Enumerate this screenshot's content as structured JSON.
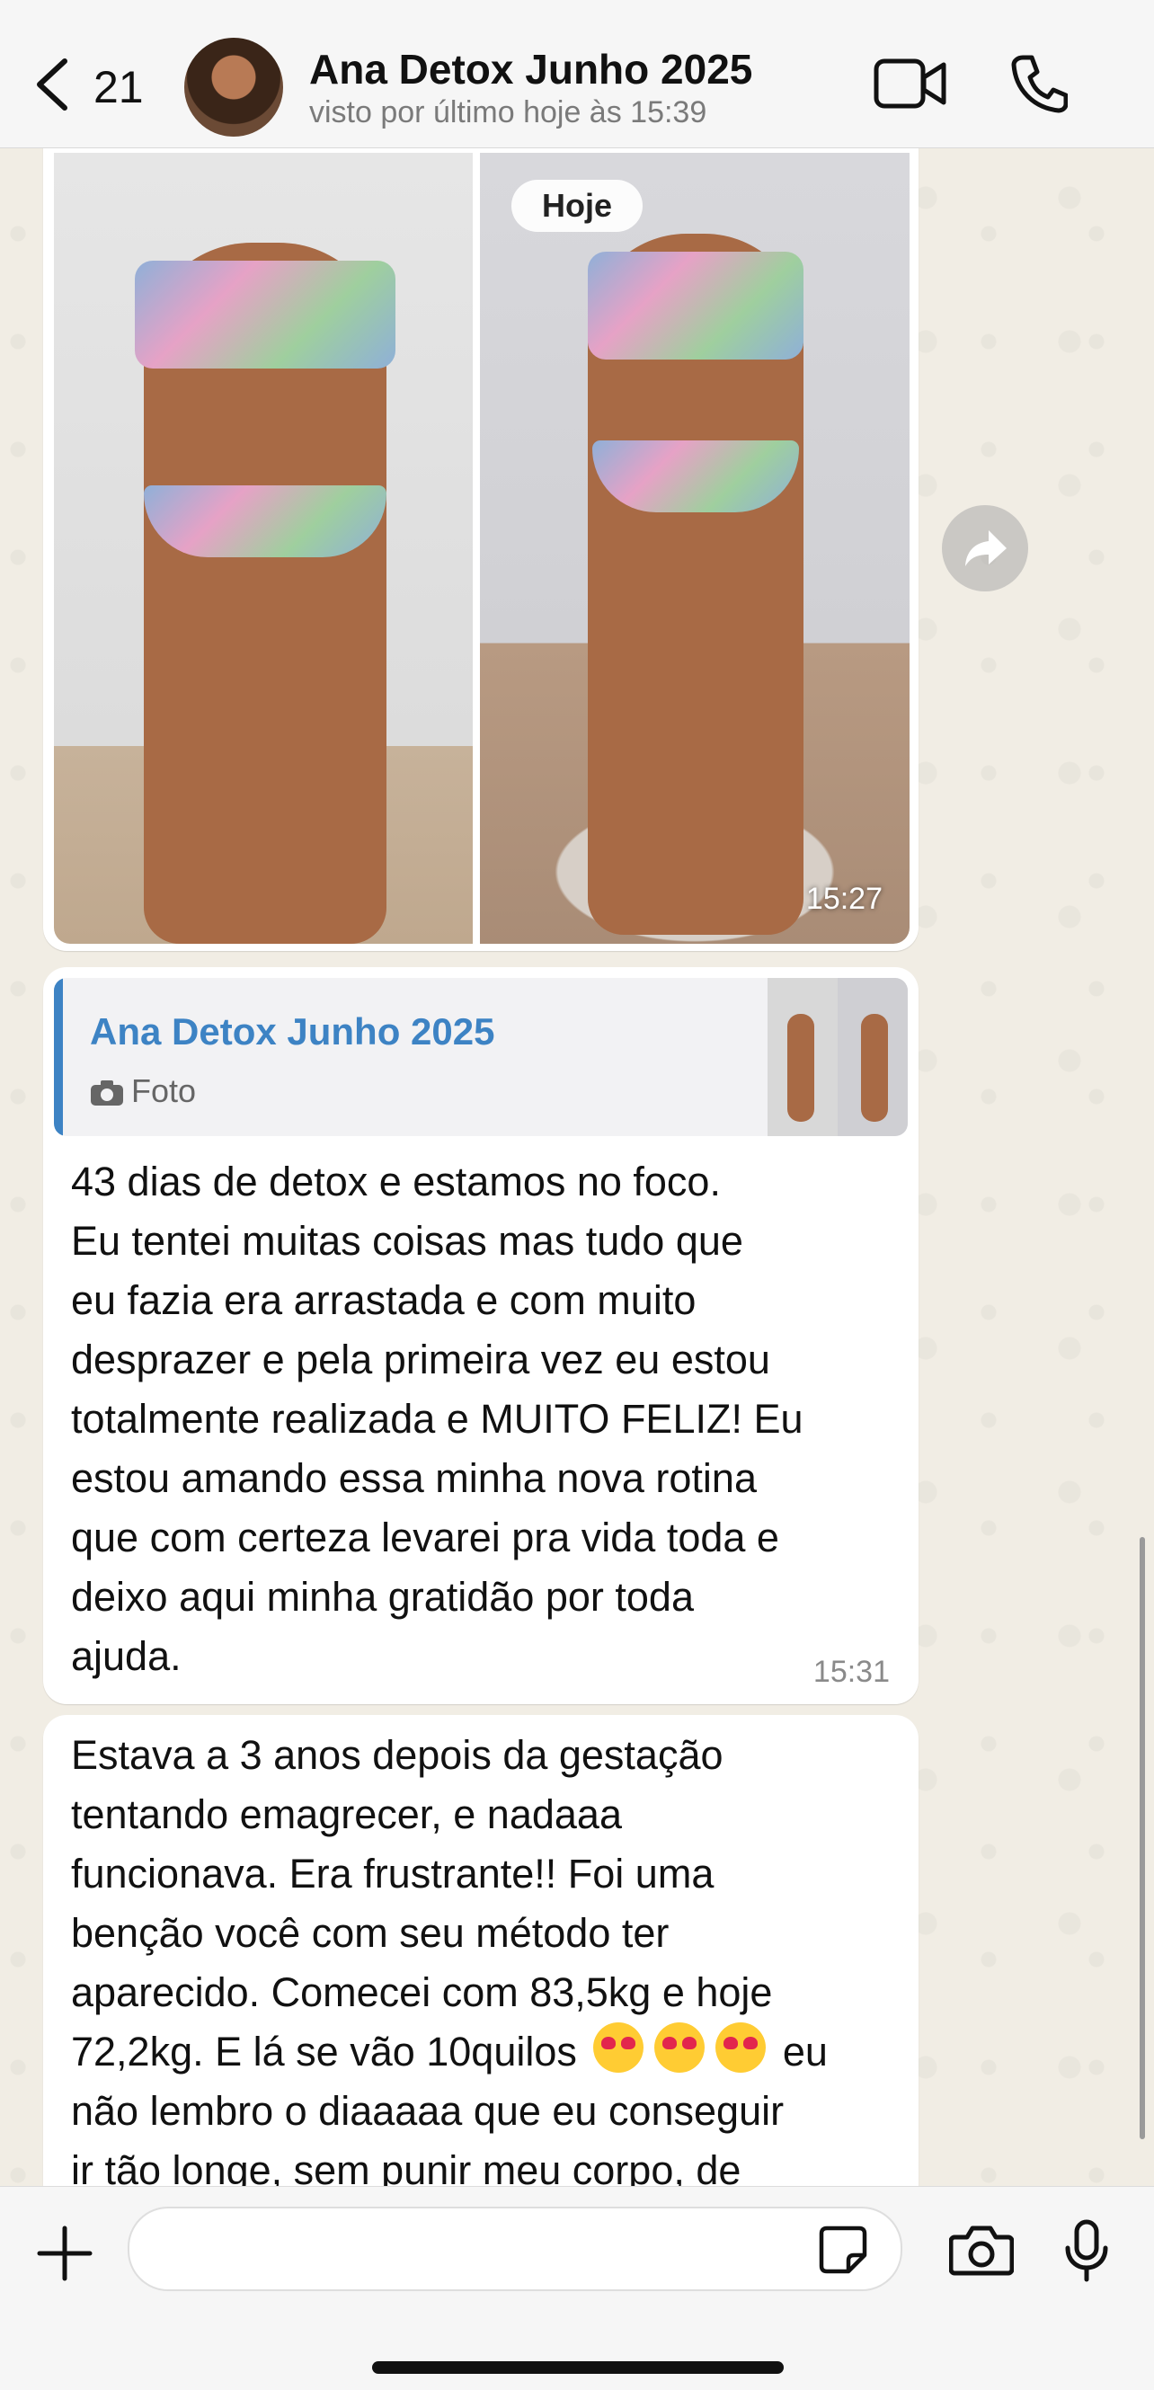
{
  "header": {
    "back_count": "21",
    "title": "Ana Detox Junho 2025",
    "subtitle": "visto por último hoje às 15:39"
  },
  "photo_message": {
    "date_chip": "Hoje",
    "time": "15:27"
  },
  "message1": {
    "quote_name": "Ana Detox Junho 2025",
    "quote_type": "Foto",
    "text": "43 dias de detox e estamos no foco.\nEu tentei muitas coisas mas tudo que\neu fazia era arrastada e com muito\ndesprazer e pela primeira vez eu estou\ntotalmente realizada e MUITO FELIZ! Eu\nestou amando essa minha nova rotina\nque com certeza levarei pra vida toda e\ndeixo aqui minha gratidão por toda\najuda.",
    "time": "15:31"
  },
  "message2": {
    "text_before_emoji": "Estava a 3 anos depois da gestação\ntentando emagrecer, e nadaaa\nfuncionava. Era frustrante!! Foi uma\nbenção você com seu método ter\naparecido. Comecei com 83,5kg e hoje\n72,2kg. E lá se vão 10quilos ",
    "text_after_emoji": " eu\nnão lembro o diaaaaa que eu conseguir\nir tão longe, sem punir meu corpo, de"
  },
  "colors": {
    "accent_blue": "#3d83c4",
    "bubble": "#ffffff",
    "wallpaper": "#f1ede4"
  },
  "icons": [
    "back-chevron-icon",
    "video-call-icon",
    "phone-icon",
    "forward-icon",
    "camera-icon",
    "plus-icon",
    "sticker-icon",
    "microphone-icon"
  ]
}
